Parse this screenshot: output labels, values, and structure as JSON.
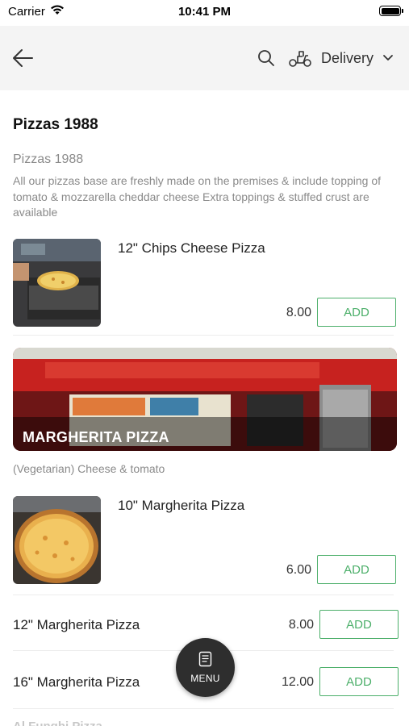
{
  "status_bar": {
    "carrier": "Carrier",
    "time": "10:41 PM"
  },
  "nav": {
    "back_icon": "arrow-left-icon",
    "search_icon": "search-icon",
    "delivery_icon": "scooter-icon",
    "delivery_label": "Delivery",
    "dropdown_icon": "chevron-down-icon"
  },
  "menu": {
    "section_title": "Pizzas 1988",
    "category_title": "Pizzas 1988",
    "category_description": "All our pizzas base are freshly made on the premises & include topping of tomato & mozzarella cheddar cheese Extra toppings & stuffed crust are available",
    "items_top": [
      {
        "name": "12\" Chips Cheese Pizza",
        "price": "8.00",
        "button": "ADD"
      }
    ],
    "banner": {
      "title": "MARGHERITA PIZZA",
      "subtitle": "(Vegetarian) Cheese & tomato"
    },
    "items_margherita": [
      {
        "name": "10\" Margherita Pizza",
        "price": "6.00",
        "button": "ADD"
      },
      {
        "name": "12\" Margherita Pizza",
        "price": "8.00",
        "button": "ADD"
      },
      {
        "name": "16\" Margherita Pizza",
        "price": "12.00",
        "button": "ADD"
      }
    ],
    "next_section_peek": "Al Funghi Pizza"
  },
  "fab": {
    "label": "MENU",
    "icon": "menu-book-icon"
  },
  "colors": {
    "accent": "#4caf6a",
    "nav_bg": "#f4f4f4",
    "fab_bg": "#2e2e2e",
    "muted_text": "#8a8a8a"
  }
}
